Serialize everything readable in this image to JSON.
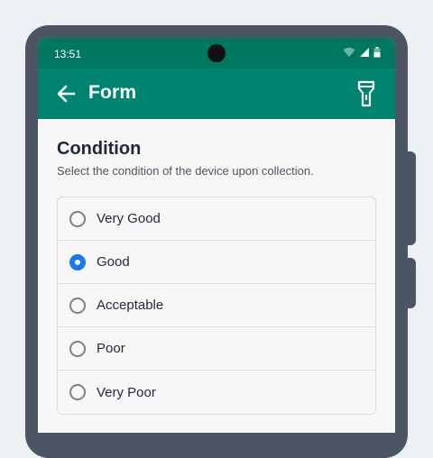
{
  "status_bar": {
    "time": "13:51"
  },
  "app_bar": {
    "title": "Form",
    "back_icon": "arrow-left-icon",
    "action_icon": "flashlight-icon"
  },
  "section": {
    "title": "Condition",
    "subtitle": "Select the condition of the device upon collection."
  },
  "options": [
    {
      "label": "Very Good",
      "selected": false
    },
    {
      "label": "Good",
      "selected": true
    },
    {
      "label": "Acceptable",
      "selected": false
    },
    {
      "label": "Poor",
      "selected": false
    },
    {
      "label": "Very Poor",
      "selected": false
    }
  ],
  "colors": {
    "status_bar": "#00775f",
    "app_bar": "#008470",
    "radio_selected": "#1877f2",
    "bezel": "#4b5563"
  }
}
